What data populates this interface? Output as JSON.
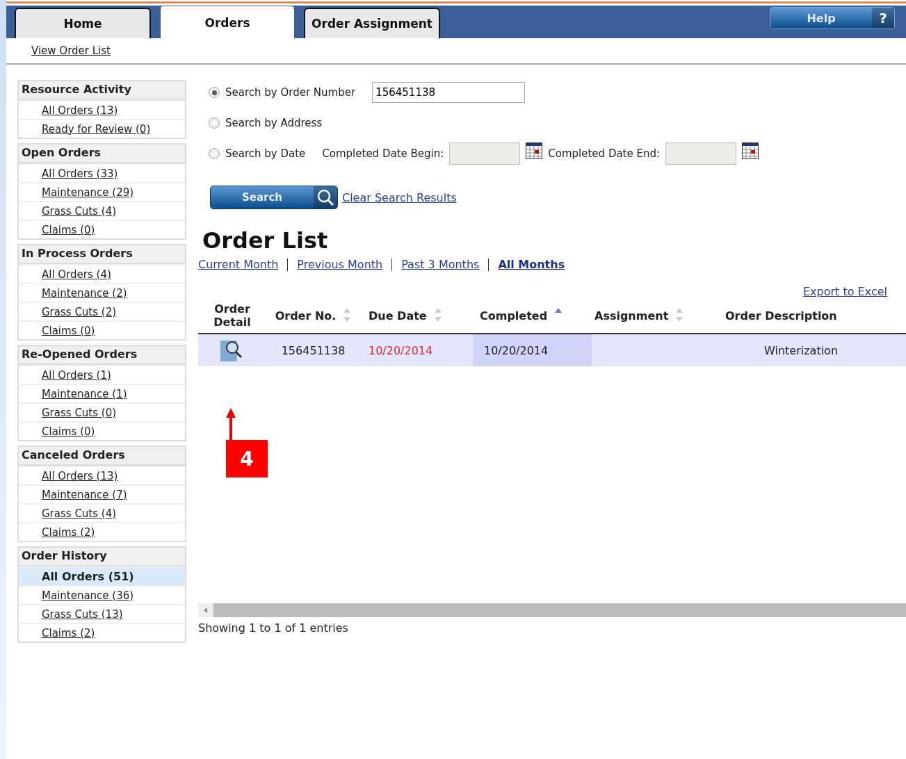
{
  "tabs": [
    {
      "label": "Home",
      "selected": false
    },
    {
      "label": "Orders",
      "selected": true
    },
    {
      "label": "Order Assignment",
      "selected": false
    }
  ],
  "help_button": {
    "label": "Help",
    "icon_text": "?"
  },
  "subnav": [
    "View Order List"
  ],
  "sidebar": [
    {
      "title": "Resource Activity",
      "items": [
        {
          "label": "All Orders (13)",
          "selected": false
        },
        {
          "label": "Ready for Review (0)",
          "selected": false
        }
      ]
    },
    {
      "title": "Open Orders",
      "items": [
        {
          "label": "All Orders (33)",
          "selected": false
        },
        {
          "label": "Maintenance (29)",
          "selected": false
        },
        {
          "label": "Grass Cuts (4)",
          "selected": false
        },
        {
          "label": "Claims (0)",
          "selected": false
        }
      ]
    },
    {
      "title": "In Process Orders",
      "items": [
        {
          "label": "All Orders (4)",
          "selected": false
        },
        {
          "label": "Maintenance (2)",
          "selected": false
        },
        {
          "label": "Grass Cuts (2)",
          "selected": false
        },
        {
          "label": "Claims (0)",
          "selected": false
        }
      ]
    },
    {
      "title": "Re-Opened Orders",
      "items": [
        {
          "label": "All Orders (1)",
          "selected": false
        },
        {
          "label": "Maintenance (1)",
          "selected": false
        },
        {
          "label": "Grass Cuts (0)",
          "selected": false
        },
        {
          "label": "Claims (0)",
          "selected": false
        }
      ]
    },
    {
      "title": "Canceled Orders",
      "items": [
        {
          "label": "All Orders (13)",
          "selected": false
        },
        {
          "label": "Maintenance (7)",
          "selected": false
        },
        {
          "label": "Grass Cuts (4)",
          "selected": false
        },
        {
          "label": "Claims (2)",
          "selected": false
        }
      ]
    },
    {
      "title": "Order History",
      "items": [
        {
          "label": "All Orders (51)",
          "selected": true
        },
        {
          "label": "Maintenance (36)",
          "selected": false
        },
        {
          "label": "Grass Cuts (13)",
          "selected": false
        },
        {
          "label": "Claims (2)",
          "selected": false
        }
      ]
    }
  ],
  "search": {
    "options": [
      {
        "label": "Search by Order Number",
        "selected": true,
        "kind": "number",
        "value": "156451138"
      },
      {
        "label": "Search by Address",
        "selected": false,
        "kind": "plain"
      },
      {
        "label": "Search by Date",
        "selected": false,
        "kind": "dates",
        "begin_label": "Completed Date Begin:",
        "end_label": "Completed Date End:"
      }
    ],
    "search_button": "Search",
    "clear_link": "Clear Search Results"
  },
  "order_list": {
    "title": "Order List",
    "periods": [
      {
        "label": "Current Month",
        "selected": false
      },
      {
        "label": "Previous Month",
        "selected": false
      },
      {
        "label": "Past 3 Months",
        "selected": false
      },
      {
        "label": "All Months",
        "selected": true
      }
    ],
    "export_link": "Export to Excel",
    "columns": [
      {
        "label": "Order Detail",
        "sortable": false,
        "sorted": false
      },
      {
        "label": "Order No.",
        "sortable": true,
        "sorted": false
      },
      {
        "label": "Due Date",
        "sortable": true,
        "sorted": false
      },
      {
        "label": "Completed",
        "sortable": true,
        "sorted": true
      },
      {
        "label": "Assignment",
        "sortable": true,
        "sorted": false
      },
      {
        "label": "Order Description",
        "sortable": false,
        "sorted": false
      }
    ],
    "rows": [
      {
        "order_no": "156451138",
        "due_date": "10/20/2014",
        "overdue": true,
        "completed": "10/20/2014",
        "description": "Winterization"
      }
    ],
    "footer": "Showing 1 to 1 of 1 entries"
  },
  "callout": {
    "label": "4"
  }
}
